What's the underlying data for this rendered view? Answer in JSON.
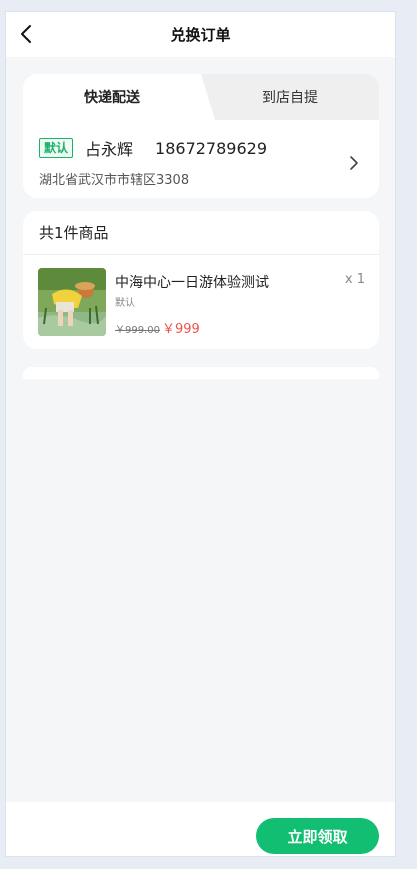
{
  "header": {
    "title": "兑换订单",
    "back_icon": "chevron-left-icon"
  },
  "delivery_tabs": [
    {
      "label": "快递配送",
      "active": true
    },
    {
      "label": "到店自提",
      "active": false
    }
  ],
  "address": {
    "badge": "默认",
    "name": "占永辉",
    "phone": "18672789629",
    "detail": "湖北省武汉市市辖区3308"
  },
  "goods": {
    "header": "共1件商品",
    "items": [
      {
        "name": "中海中心一日游体验测试",
        "quantity": "x 1",
        "spec": "默认",
        "original_price": "￥999.00",
        "price": "￥999"
      }
    ]
  },
  "footer": {
    "claim_label": "立即领取"
  },
  "colors": {
    "accent": "#12bf72",
    "price": "#f0524c",
    "badge": "#1ab36b"
  }
}
